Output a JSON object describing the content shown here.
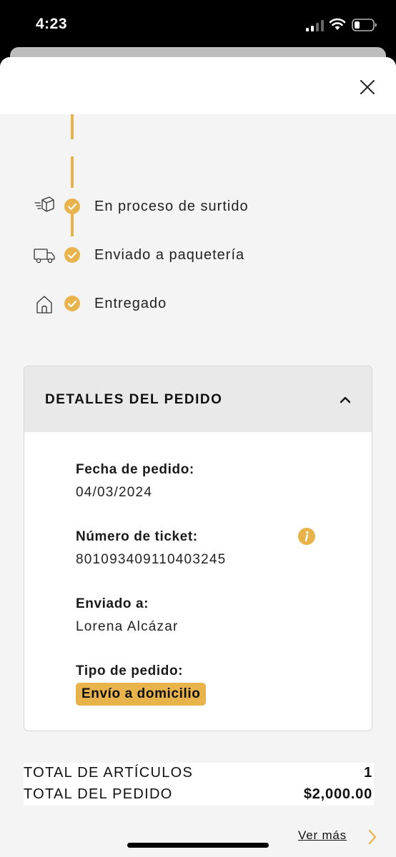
{
  "status_bar": {
    "time": "4:23",
    "signal_icon": "cellular-signal-icon",
    "wifi_icon": "wifi-icon",
    "battery_icon": "battery-low-icon"
  },
  "modal": {
    "close_icon": "close-icon"
  },
  "timeline": {
    "steps": [
      {
        "label": "En proceso de surtido",
        "icon": "box-moving-icon",
        "status_icon": "check-circle-icon"
      },
      {
        "label": "Enviado a paquetería",
        "icon": "delivery-truck-icon",
        "status_icon": "check-circle-icon"
      },
      {
        "label": "Entregado",
        "icon": "house-icon",
        "status_icon": "check-circle-icon"
      }
    ]
  },
  "details": {
    "title": "DETALLES DEL PEDIDO",
    "toggle_icon": "chevron-up-icon",
    "order_date_label": "Fecha de pedido:",
    "order_date_value": "04/03/2024",
    "ticket_label": "Número de ticket:",
    "ticket_value": "801093409110403245",
    "ticket_info_icon": "info-icon",
    "shipped_to_label": "Enviado a:",
    "shipped_to_value": "Lorena Alcázar",
    "order_type_label": "Tipo de pedido:",
    "order_type_value": "Envío a domicilio"
  },
  "totals": {
    "items_label": "TOTAL DE ARTÍCULOS",
    "items_value": "1",
    "order_label": "TOTAL DEL PEDIDO",
    "order_value": "$2,000.00"
  },
  "footer": {
    "see_more_label": "Ver más",
    "see_more_icon": "chevron-right-icon"
  },
  "colors": {
    "accent": "#e8b34b",
    "background": "#f4f4f4",
    "text": "#111111"
  }
}
